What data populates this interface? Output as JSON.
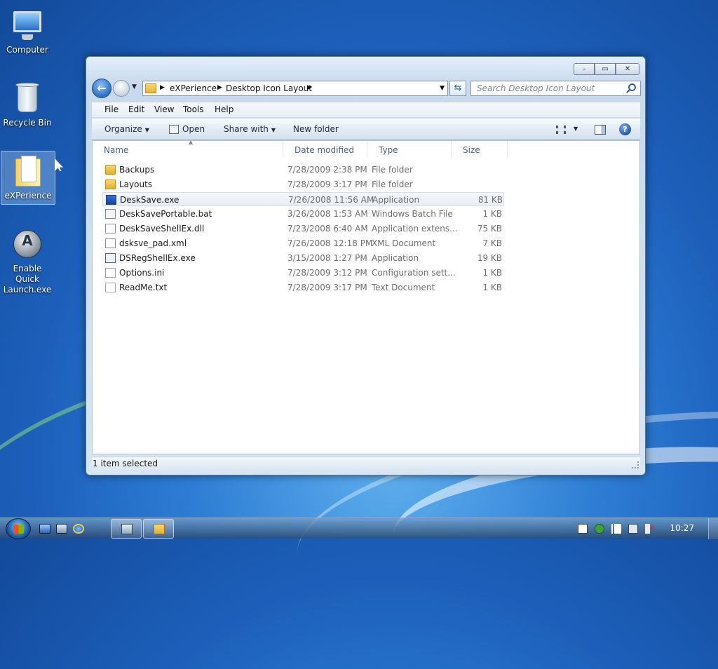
{
  "desktop": {
    "icons": [
      {
        "label": "Computer"
      },
      {
        "label": "Recycle Bin"
      },
      {
        "label": "eXPerience"
      },
      {
        "label": "Enable Quick Launch.exe"
      }
    ]
  },
  "window": {
    "address": {
      "crumbs": [
        "eXPerience",
        "Desktop Icon Layout"
      ]
    },
    "search": {
      "placeholder": "Search Desktop Icon Layout"
    },
    "menu": [
      "File",
      "Edit",
      "View",
      "Tools",
      "Help"
    ],
    "toolbar": {
      "organize": "Organize",
      "open": "Open",
      "share_with": "Share with",
      "new_folder": "New folder"
    },
    "columns": {
      "name": "Name",
      "date": "Date modified",
      "type": "Type",
      "size": "Size"
    },
    "files": [
      {
        "name": "Backups",
        "date": "7/28/2009 2:38 PM",
        "type": "File folder",
        "size": "",
        "icon": "folder-icon"
      },
      {
        "name": "Layouts",
        "date": "7/28/2009 3:17 PM",
        "type": "File folder",
        "size": "",
        "icon": "folder-icon"
      },
      {
        "name": "DeskSave.exe",
        "date": "7/26/2008 11:56 AM",
        "type": "Application",
        "size": "81 KB",
        "icon": "application-icon",
        "selected": true
      },
      {
        "name": "DeskSavePortable.bat",
        "date": "3/26/2008 1:53 AM",
        "type": "Windows Batch File",
        "size": "1 KB",
        "icon": "batch-file-icon"
      },
      {
        "name": "DeskSaveShellEx.dll",
        "date": "7/23/2008 6:40 AM",
        "type": "Application extens...",
        "size": "75 KB",
        "icon": "dll-file-icon"
      },
      {
        "name": "dsksve_pad.xml",
        "date": "7/26/2008 12:18 PM",
        "type": "XML Document",
        "size": "7 KB",
        "icon": "xml-file-icon"
      },
      {
        "name": "DSRegShellEx.exe",
        "date": "3/15/2008 1:27 PM",
        "type": "Application",
        "size": "19 KB",
        "icon": "application-icon"
      },
      {
        "name": "Options.ini",
        "date": "7/28/2009 3:12 PM",
        "type": "Configuration sett...",
        "size": "1 KB",
        "icon": "config-file-icon"
      },
      {
        "name": "ReadMe.txt",
        "date": "7/28/2009 3:17 PM",
        "type": "Text Document",
        "size": "1 KB",
        "icon": "text-file-icon"
      }
    ],
    "status": "1 item selected"
  },
  "taskbar": {
    "clock": "10:27"
  },
  "colors": {
    "accent": "#2d6fc2",
    "selection": "#e8eef5"
  }
}
